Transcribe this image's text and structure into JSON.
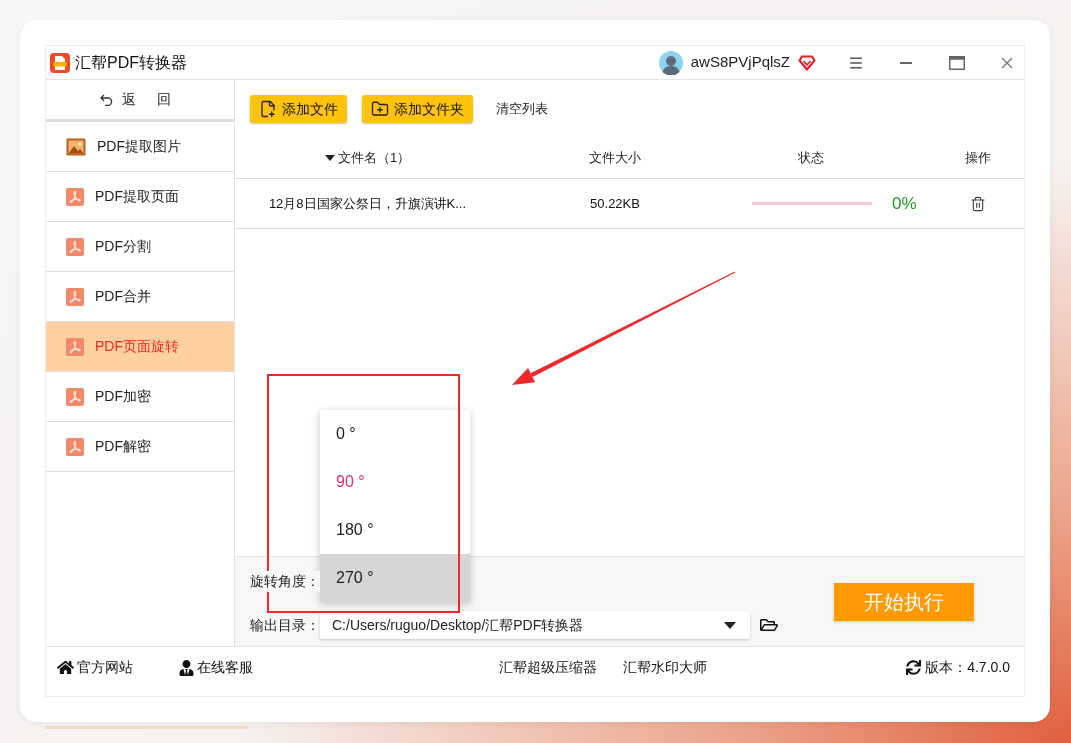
{
  "window": {
    "title": "汇帮PDF转换器",
    "username": "awS8PVjPqlsZ"
  },
  "sidebar": {
    "back": "返 回",
    "items": [
      {
        "label": "PDF提取图片",
        "kind": "image",
        "selected": false
      },
      {
        "label": "PDF提取页面",
        "kind": "pdf",
        "selected": false
      },
      {
        "label": "PDF分割",
        "kind": "pdf",
        "selected": false
      },
      {
        "label": "PDF合并",
        "kind": "pdf",
        "selected": false
      },
      {
        "label": "PDF页面旋转",
        "kind": "pdf",
        "selected": true
      },
      {
        "label": "PDF加密",
        "kind": "pdf",
        "selected": false
      },
      {
        "label": "PDF解密",
        "kind": "pdf",
        "selected": false
      }
    ]
  },
  "toolbar": {
    "buttons": [
      {
        "label": "添加文件",
        "kind": "file"
      },
      {
        "label": "添加文件夹",
        "kind": "folder"
      }
    ],
    "clear": "清空列表"
  },
  "table": {
    "columns": [
      {
        "label": "文件名（1）",
        "sorted": true
      },
      {
        "label": "文件大小",
        "sorted": false
      },
      {
        "label": "状态",
        "sorted": false
      },
      {
        "label": "操作",
        "sorted": false
      }
    ],
    "rows": [
      {
        "name": "12月8日国家公祭日，升旗演讲K...",
        "size": "50.22KB",
        "progress": "0%"
      }
    ]
  },
  "settings": {
    "angle_label": "旋转角度：",
    "output_label": "输出目录：",
    "output_path": "C:/Users/ruguo/Desktop/汇帮PDF转换器",
    "start": "开始执行"
  },
  "angle_menu": [
    {
      "label": "0 °",
      "selected": false,
      "hovered": false
    },
    {
      "label": "90 °",
      "selected": true,
      "hovered": false
    },
    {
      "label": "180 °",
      "selected": false,
      "hovered": false
    },
    {
      "label": "270 °",
      "selected": false,
      "hovered": true
    }
  ],
  "footer": {
    "links": [
      {
        "label": "官方网站",
        "kind": "home"
      },
      {
        "label": "在线客服",
        "kind": "support"
      },
      {
        "label": "汇帮超级压缩器",
        "kind": "plain"
      },
      {
        "label": "汇帮水印大师",
        "kind": "plain"
      }
    ],
    "version": "版本：4.7.0.0"
  }
}
